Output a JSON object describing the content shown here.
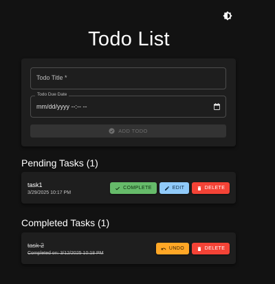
{
  "header": {
    "title": "Todo List",
    "theme_toggle_icon": "brightness-icon"
  },
  "form": {
    "title_placeholder": "Todo Title  *",
    "date_label": "Todo Due Date",
    "date_value": "mm/dd/yyyy --:-- --",
    "add_button_label": "ADD TODO",
    "add_button_disabled": true
  },
  "pending": {
    "heading": "Pending Tasks (1)",
    "tasks": [
      {
        "title": "task1",
        "date": "3/29/2025 10:17 PM",
        "complete_label": "COMPLETE",
        "edit_label": "EDIT",
        "delete_label": "DELETE"
      }
    ]
  },
  "completed": {
    "heading": "Completed Tasks (1)",
    "tasks": [
      {
        "title": "task 2",
        "date": "Completed on: 3/12/2025 10:18 PM",
        "undo_label": "UNDO",
        "delete_label": "DELETE"
      }
    ]
  },
  "colors": {
    "background": "#121212",
    "card": "#1e1e1e",
    "complete": "#66bb6a",
    "edit": "#90caf9",
    "delete": "#f44336",
    "undo": "#ffa726"
  }
}
